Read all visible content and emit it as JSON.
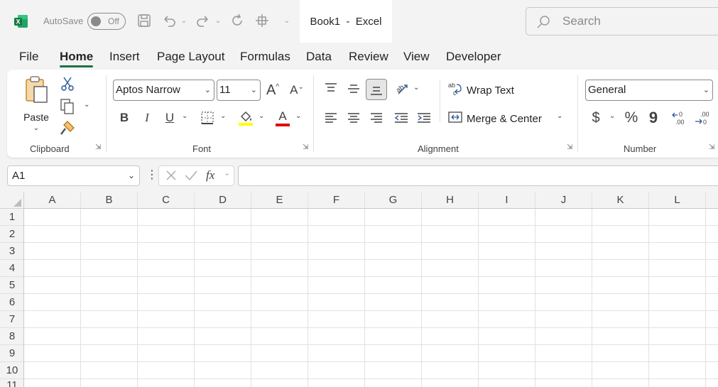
{
  "app": {
    "logo_icon": "excel-logo-icon",
    "brand_color": "#1e7145",
    "autosave_label": "AutoSave",
    "autosave_state": "Off",
    "document_title": "Book1  -  Excel",
    "search_placeholder": "Search"
  },
  "menu": {
    "items": [
      "File",
      "Home",
      "Insert",
      "Page Layout",
      "Formulas",
      "Data",
      "Review",
      "View",
      "Developer"
    ],
    "active": "Home"
  },
  "ribbon": {
    "clipboard": {
      "label": "Clipboard",
      "paste_label": "Paste"
    },
    "font": {
      "label": "Font",
      "font_name": "Aptos Narrow",
      "font_size": "11",
      "bold": "B",
      "italic": "I",
      "underline": "U",
      "font_color_letter": "A",
      "highlight_color": "#ffff00",
      "font_color": "#e00000"
    },
    "alignment": {
      "label": "Alignment",
      "wrap_text": "Wrap Text",
      "merge_center": "Merge & Center"
    },
    "number": {
      "label": "Number",
      "format": "General",
      "currency": "$",
      "percent": "%",
      "comma": "9"
    }
  },
  "formula_bar": {
    "name_box": "A1",
    "fx": "fx",
    "formula": ""
  },
  "sheet": {
    "columns": [
      "A",
      "B",
      "C",
      "D",
      "E",
      "F",
      "G",
      "H",
      "I",
      "J",
      "K",
      "L"
    ],
    "rows": [
      "1",
      "2",
      "3",
      "4",
      "5",
      "6",
      "7",
      "8",
      "9",
      "10",
      "11"
    ]
  }
}
